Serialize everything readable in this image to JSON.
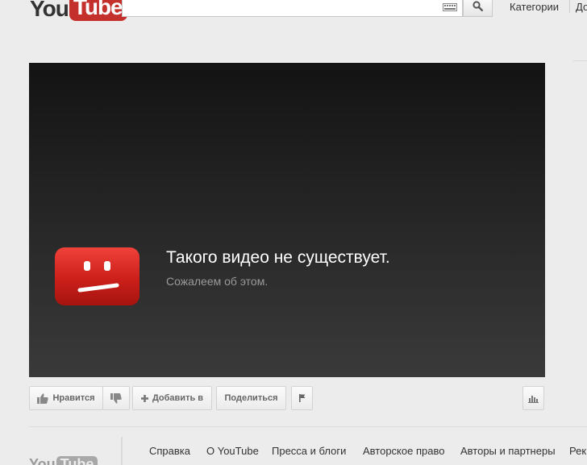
{
  "header": {
    "logo_you": "You",
    "logo_tube": "Tube",
    "search_value": "",
    "nav": [
      "Категории",
      "До"
    ]
  },
  "player": {
    "error_title": "Такого видео не существует.",
    "error_subtitle": "Сожалеем об этом."
  },
  "actions": {
    "like": "Нравится",
    "add_to": "Добавить в",
    "share": "Поделиться"
  },
  "footer": {
    "logo_you": "You",
    "logo_tube": "Tube",
    "links": [
      "Справка",
      "О YouTube",
      "Пресса и блоги",
      "Авторское право",
      "Авторы и партнеры",
      "Рек"
    ]
  },
  "colors": {
    "brand_red": "#c4302b",
    "page_bg": "#ececec"
  }
}
